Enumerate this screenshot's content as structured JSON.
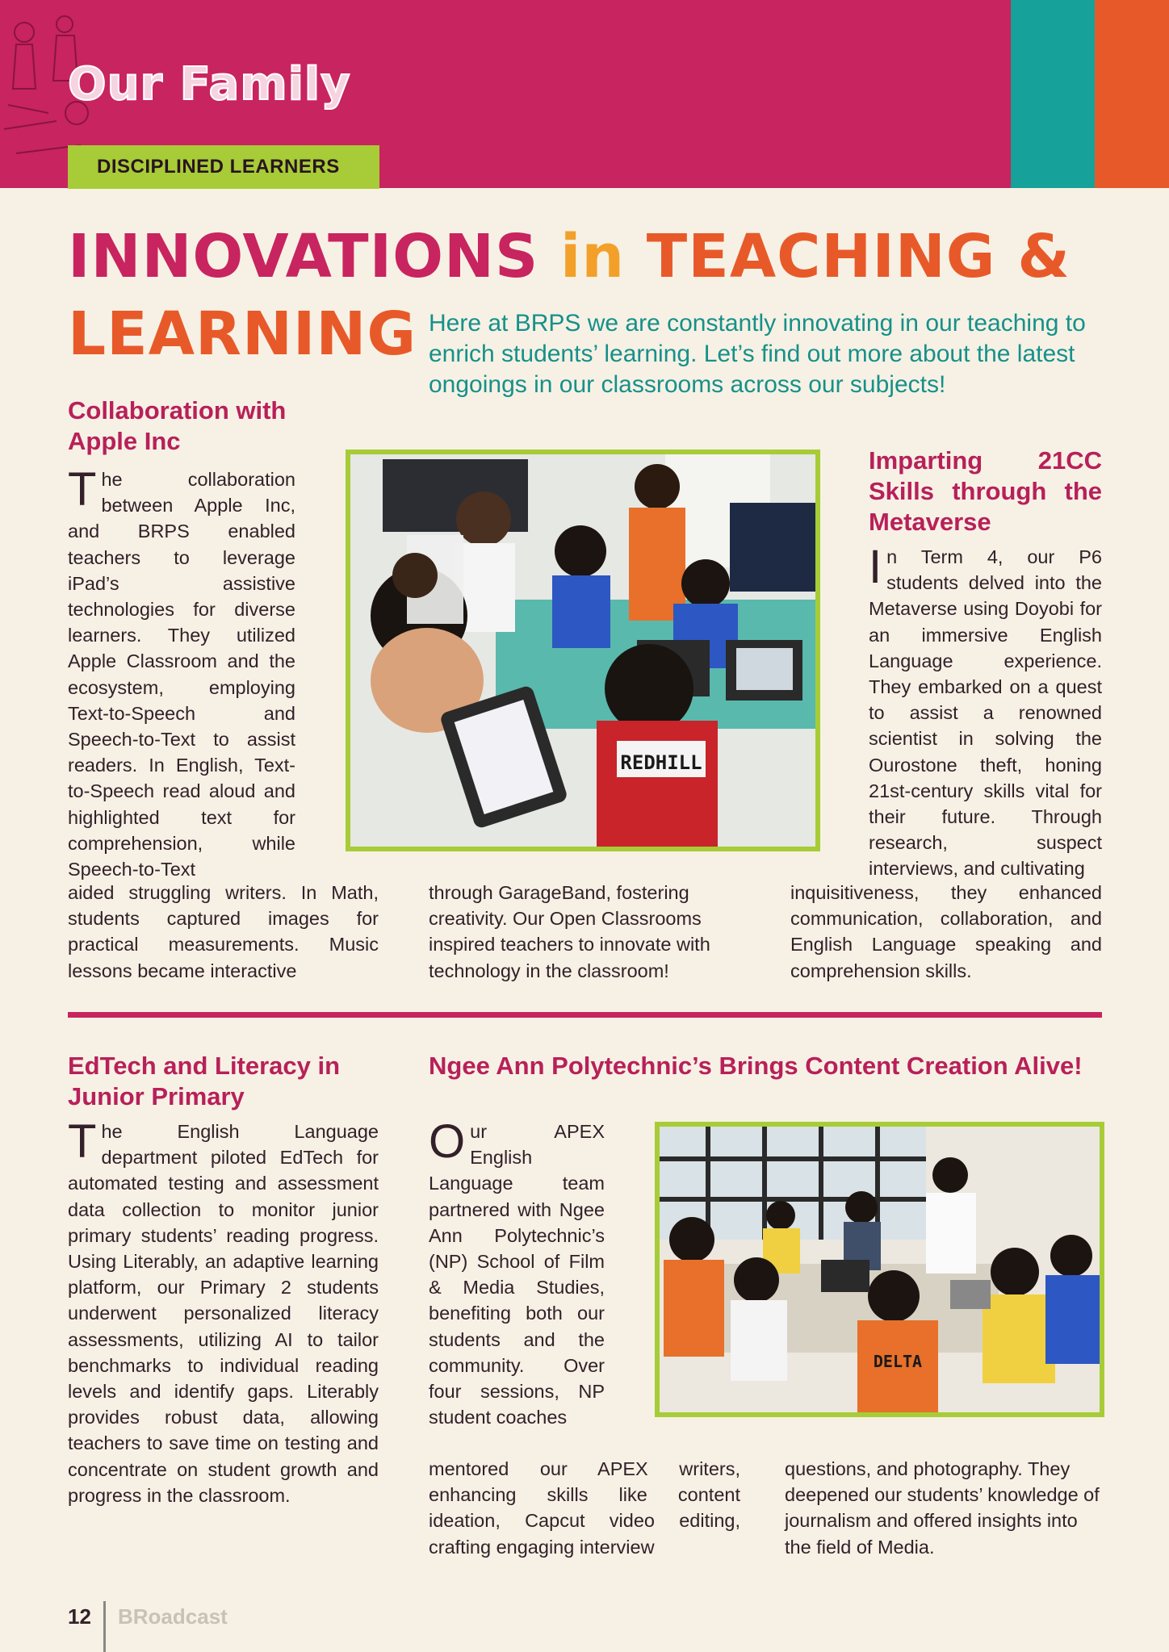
{
  "header": {
    "section_title": "Our Family",
    "tag": "DISCIPLINED LEARNERS"
  },
  "headline": {
    "part1": "INNOVATIONS ",
    "part2": "in",
    "part3": " TEACHING &",
    "part4": "LEARNING"
  },
  "intro": "Here at BRPS we are constantly innovating in our teaching to enrich students’ learning. Let’s find out more about the latest ongoings in our classrooms across our subjects!",
  "articles": {
    "apple": {
      "title": "Collaboration with Apple Inc",
      "dropcap": "T",
      "col1_text": "he collaboration between Apple Inc, and BRPS enabled teachers to leverage iPad’s assistive technologies for diverse learners. They utilized Apple Classroom and the ecosystem, employing Text-to-Speech and Speech-to-Text to assist readers. In English, Text-to-Speech read aloud and highlighted text for comprehension, while Speech-to-Text",
      "col1_cont": "aided struggling writers. In Math, students captured images for practical measurements. Music lessons became interactive",
      "col2_text": "through GarageBand, fostering creativity. Our Open Classrooms inspired teachers to innovate with technology in the classroom!",
      "photo_label": "REDHILL"
    },
    "metaverse": {
      "title": "Imparting 21CC Skills through the Metaverse",
      "dropcap": "I",
      "text": "n Term 4, our P6 students delved into the Metaverse using Doyobi for an immersive English Language experience. They embarked on a quest to assist a renowned scientist in solving the Ourostone theft, honing 21st-century skills vital for their future. Through research, suspect interviews, and cultivating",
      "text_cont": "inquisitiveness, they enhanced communication, collaboration, and English Language speaking and comprehension skills."
    },
    "edtech": {
      "title": "EdTech and Literacy in Junior Primary",
      "dropcap": "T",
      "text": "he English Language department piloted EdTech for automated testing and assessment data collection to monitor junior primary students’ reading progress. Using Literably, an adaptive learning platform, our Primary 2 students underwent personalized literacy assessments, utilizing AI to tailor benchmarks to individual reading levels and identify gaps. Literably provides robust data, allowing teachers to save time on testing and concentrate on student growth and progress in the classroom."
    },
    "ngee_ann": {
      "title": "Ngee Ann Polytechnic’s Brings Content Creation Alive!",
      "dropcap": "O",
      "text": "ur APEX English Language team partnered with Ngee Ann Polytechnic’s (NP) School of Film & Media Studies, benefiting both our students and the community. Over four sessions, NP student coaches",
      "text_cont": "mentored our APEX writers, enhancing skills like content ideation, Capcut video editing, crafting engaging interview",
      "col3_text": "questions, and photography. They deepened our students’ knowledge of journalism and offered insights into the field of Media.",
      "photo_label": "DELTA"
    }
  },
  "footer": {
    "page_number": "12",
    "publication": "BRoadcast"
  },
  "colors": {
    "magenta": "#c8245f",
    "teal": "#16a19a",
    "orange": "#e8592a",
    "lime": "#a7cc37",
    "background": "#f6f1e4"
  }
}
